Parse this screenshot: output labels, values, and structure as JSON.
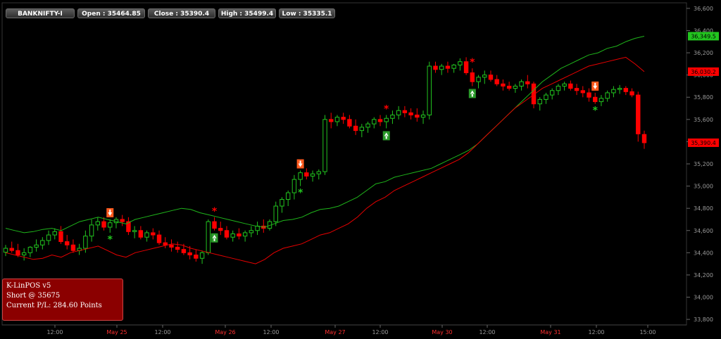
{
  "header": {
    "symbol": "BANKNIFTY-I",
    "open": "Open : 35464.85",
    "close": "Close : 35390.4",
    "high": "High : 35499.4",
    "low": "Low : 35335.1"
  },
  "info_box": {
    "title": "K-LinPOS v5",
    "position": "Short @ 35675",
    "pnl": "Current P/L: 284.60 Points"
  },
  "colors": {
    "up": "#22c41f",
    "down": "#ff0000",
    "upper_band": "#1fb51b",
    "lower_band": "#e80000",
    "grid": "#2a2a2a",
    "axis_text": "#9a9a9a",
    "info_bg": "#8b0000"
  },
  "chart_data": {
    "type": "candlestick",
    "title": "BANKNIFTY-I",
    "y_tick_labels": [
      "36,600",
      "36,400",
      "36,200",
      "36,000",
      "35,800",
      "35,600",
      "35,400",
      "35,200",
      "35,000",
      "34,800",
      "34,600",
      "34,400",
      "34,200",
      "34,000",
      "33,800"
    ],
    "ylim": [
      33750,
      36650
    ],
    "x_tick_labels": [
      "12:00",
      "May 25",
      "12:00",
      "May 26",
      "12:00",
      "May 27",
      "12:00",
      "May 30",
      "12:00",
      "May 31",
      "12:00",
      "15:00"
    ],
    "price_badges": [
      {
        "label": "36,349.5",
        "value": 36349.5,
        "color": "#22c41f"
      },
      {
        "label": "36,030.2",
        "value": 36030.2,
        "color": "#ff0000"
      },
      {
        "label": "35,390.4",
        "value": 35390.4,
        "color": "#ff0000"
      }
    ],
    "candles": [
      [
        34405,
        34470,
        34370,
        34440
      ],
      [
        34440,
        34500,
        34400,
        34420
      ],
      [
        34420,
        34480,
        34360,
        34380
      ],
      [
        34380,
        34440,
        34330,
        34400
      ],
      [
        34400,
        34460,
        34360,
        34450
      ],
      [
        34450,
        34520,
        34410,
        34470
      ],
      [
        34470,
        34540,
        34430,
        34510
      ],
      [
        34510,
        34600,
        34470,
        34560
      ],
      [
        34560,
        34620,
        34520,
        34590
      ],
      [
        34590,
        34640,
        34480,
        34500
      ],
      [
        34500,
        34560,
        34430,
        34470
      ],
      [
        34470,
        34520,
        34400,
        34420
      ],
      [
        34420,
        34480,
        34380,
        34440
      ],
      [
        34440,
        34600,
        34400,
        34550
      ],
      [
        34550,
        34700,
        34500,
        34650
      ],
      [
        34650,
        34720,
        34600,
        34680
      ],
      [
        34680,
        34720,
        34600,
        34630
      ],
      [
        34630,
        34700,
        34580,
        34670
      ],
      [
        34670,
        34720,
        34620,
        34700
      ],
      [
        34700,
        34740,
        34640,
        34680
      ],
      [
        34680,
        34720,
        34560,
        34590
      ],
      [
        34590,
        34640,
        34530,
        34600
      ],
      [
        34600,
        34640,
        34520,
        34540
      ],
      [
        34540,
        34600,
        34500,
        34580
      ],
      [
        34580,
        34620,
        34520,
        34560
      ],
      [
        34560,
        34600,
        34470,
        34490
      ],
      [
        34490,
        34540,
        34440,
        34470
      ],
      [
        34470,
        34520,
        34410,
        34450
      ],
      [
        34450,
        34500,
        34400,
        34430
      ],
      [
        34430,
        34480,
        34380,
        34400
      ],
      [
        34400,
        34460,
        34340,
        34380
      ],
      [
        34380,
        34430,
        34320,
        34350
      ],
      [
        34350,
        34420,
        34300,
        34400
      ],
      [
        34400,
        34700,
        34380,
        34680
      ],
      [
        34680,
        34720,
        34600,
        34620
      ],
      [
        34620,
        34680,
        34560,
        34600
      ],
      [
        34600,
        34640,
        34520,
        34540
      ],
      [
        34540,
        34600,
        34500,
        34570
      ],
      [
        34570,
        34620,
        34520,
        34550
      ],
      [
        34550,
        34600,
        34500,
        34580
      ],
      [
        34580,
        34640,
        34540,
        34600
      ],
      [
        34600,
        34680,
        34560,
        34640
      ],
      [
        34640,
        34700,
        34580,
        34620
      ],
      [
        34620,
        34700,
        34600,
        34680
      ],
      [
        34680,
        34860,
        34640,
        34820
      ],
      [
        34820,
        34900,
        34760,
        34880
      ],
      [
        34880,
        34960,
        34820,
        34940
      ],
      [
        34940,
        35100,
        34880,
        35060
      ],
      [
        35060,
        35140,
        35000,
        35120
      ],
      [
        35120,
        35160,
        35060,
        35090
      ],
      [
        35090,
        35140,
        35040,
        35110
      ],
      [
        35110,
        35150,
        35060,
        35130
      ],
      [
        35130,
        35640,
        35100,
        35600
      ],
      [
        35600,
        35660,
        35520,
        35580
      ],
      [
        35580,
        35640,
        35540,
        35620
      ],
      [
        35620,
        35660,
        35560,
        35600
      ],
      [
        35600,
        35640,
        35520,
        35540
      ],
      [
        35540,
        35600,
        35460,
        35500
      ],
      [
        35500,
        35560,
        35440,
        35530
      ],
      [
        35530,
        35580,
        35480,
        35560
      ],
      [
        35560,
        35620,
        35520,
        35600
      ],
      [
        35600,
        35640,
        35540,
        35580
      ],
      [
        35580,
        35640,
        35520,
        35610
      ],
      [
        35610,
        35680,
        35560,
        35640
      ],
      [
        35640,
        35720,
        35600,
        35680
      ],
      [
        35680,
        35720,
        35620,
        35660
      ],
      [
        35660,
        35700,
        35600,
        35640
      ],
      [
        35640,
        35700,
        35580,
        35620
      ],
      [
        35620,
        35680,
        35560,
        35640
      ],
      [
        35640,
        36120,
        35600,
        36080
      ],
      [
        36080,
        36120,
        36020,
        36050
      ],
      [
        36050,
        36100,
        36000,
        36080
      ],
      [
        36080,
        36120,
        36020,
        36060
      ],
      [
        36060,
        36100,
        36020,
        36090
      ],
      [
        36090,
        36150,
        36040,
        36120
      ],
      [
        36120,
        36160,
        36000,
        36020
      ],
      [
        36020,
        36060,
        35900,
        35940
      ],
      [
        35940,
        36000,
        35880,
        35980
      ],
      [
        35980,
        36040,
        35920,
        36000
      ],
      [
        36000,
        36040,
        35940,
        35960
      ],
      [
        35960,
        36000,
        35900,
        35920
      ],
      [
        35920,
        35960,
        35860,
        35900
      ],
      [
        35900,
        35940,
        35860,
        35880
      ],
      [
        35880,
        35920,
        35840,
        35900
      ],
      [
        35900,
        35960,
        35860,
        35940
      ],
      [
        35940,
        36000,
        35880,
        35920
      ],
      [
        35920,
        35940,
        35700,
        35740
      ],
      [
        35740,
        35800,
        35680,
        35780
      ],
      [
        35780,
        35840,
        35740,
        35820
      ],
      [
        35820,
        35880,
        35780,
        35860
      ],
      [
        35860,
        35920,
        35820,
        35900
      ],
      [
        35900,
        35940,
        35860,
        35920
      ],
      [
        35920,
        35950,
        35860,
        35880
      ],
      [
        35880,
        35920,
        35820,
        35860
      ],
      [
        35860,
        35900,
        35800,
        35840
      ],
      [
        35840,
        35880,
        35760,
        35800
      ],
      [
        35800,
        35840,
        35740,
        35760
      ],
      [
        35760,
        35820,
        35720,
        35790
      ],
      [
        35790,
        35860,
        35760,
        35840
      ],
      [
        35840,
        35900,
        35800,
        35870
      ],
      [
        35870,
        35910,
        35830,
        35880
      ],
      [
        35880,
        35900,
        35820,
        35850
      ],
      [
        35850,
        35880,
        35800,
        35820
      ],
      [
        35820,
        35850,
        35400,
        35470
      ],
      [
        35464.85,
        35499.4,
        35335.1,
        35390.4
      ]
    ],
    "upper_band": [
      34620,
      34600,
      34580,
      34590,
      34610,
      34620,
      34600,
      34640,
      34680,
      34700,
      34720,
      34700,
      34680,
      34660,
      34700,
      34720,
      34740,
      34760,
      34780,
      34800,
      34790,
      34760,
      34740,
      34720,
      34700,
      34680,
      34660,
      34640,
      34630,
      34660,
      34690,
      34700,
      34720,
      34760,
      34790,
      34800,
      34820,
      34860,
      34900,
      34960,
      35020,
      35040,
      35080,
      35100,
      35120,
      35140,
      35160,
      35200,
      35240,
      35280,
      35320,
      35380,
      35460,
      35540,
      35620,
      35700,
      35780,
      35860,
      35940,
      36000,
      36060,
      36100,
      36140,
      36180,
      36200,
      36240,
      36260,
      36300,
      36330,
      36349.5
    ],
    "lower_band": [
      34400,
      34380,
      34360,
      34340,
      34350,
      34380,
      34360,
      34400,
      34420,
      34440,
      34460,
      34420,
      34380,
      34360,
      34400,
      34420,
      34440,
      34460,
      34480,
      34470,
      34440,
      34420,
      34400,
      34380,
      34360,
      34340,
      34320,
      34300,
      34340,
      34400,
      34440,
      34460,
      34480,
      34520,
      34560,
      34580,
      34620,
      34660,
      34720,
      34800,
      34860,
      34900,
      34960,
      35000,
      35040,
      35080,
      35120,
      35160,
      35200,
      35240,
      35300,
      35380,
      35460,
      35540,
      35620,
      35700,
      35760,
      35820,
      35880,
      35920,
      35960,
      36000,
      36040,
      36080,
      36100,
      36120,
      36140,
      36160,
      36100,
      36030.2
    ],
    "signals": [
      {
        "type": "sell",
        "index": 17
      },
      {
        "type": "buy",
        "index": 34
      },
      {
        "type": "sell",
        "index": 48
      },
      {
        "type": "buy",
        "index": 62
      },
      {
        "type": "buy",
        "index": 76
      },
      {
        "type": "sell",
        "index": 96
      }
    ]
  }
}
